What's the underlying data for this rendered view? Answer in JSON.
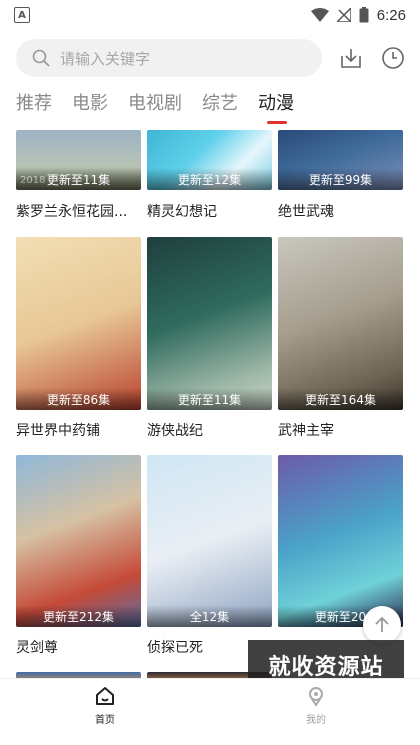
{
  "status_bar": {
    "time": "6:26",
    "notification_icon": "a-icon"
  },
  "search": {
    "placeholder": "请输入关键字"
  },
  "tabs": [
    {
      "label": "推荐"
    },
    {
      "label": "电影"
    },
    {
      "label": "电视剧"
    },
    {
      "label": "综艺"
    },
    {
      "label": "动漫",
      "active": true
    }
  ],
  "grid": {
    "rows": [
      [
        {
          "title": "紫罗兰永恒花园...",
          "badge": "更新至11集",
          "year_overlay": "2018"
        },
        {
          "title": "精灵幻想记",
          "badge": "更新至12集"
        },
        {
          "title": "绝世武魂",
          "badge": "更新至99集"
        }
      ],
      [
        {
          "title": "异世界中药铺",
          "badge": "更新至86集"
        },
        {
          "title": "游侠战纪",
          "badge": "更新至11集"
        },
        {
          "title": "武神主宰",
          "badge": "更新至164集"
        }
      ],
      [
        {
          "title": "灵剑尊",
          "badge": "更新至212集"
        },
        {
          "title": "侦探已死",
          "badge": "全12集"
        },
        {
          "title": "",
          "badge": "更新至20"
        }
      ]
    ]
  },
  "watermark": "就收资源站",
  "bottom_nav": [
    {
      "label": "首页",
      "icon": "home-icon",
      "active": true
    },
    {
      "label": "我的",
      "icon": "profile-icon",
      "active": false
    }
  ],
  "colors": {
    "accent": "#e0312f",
    "tab_inactive": "#8a8a8a"
  }
}
